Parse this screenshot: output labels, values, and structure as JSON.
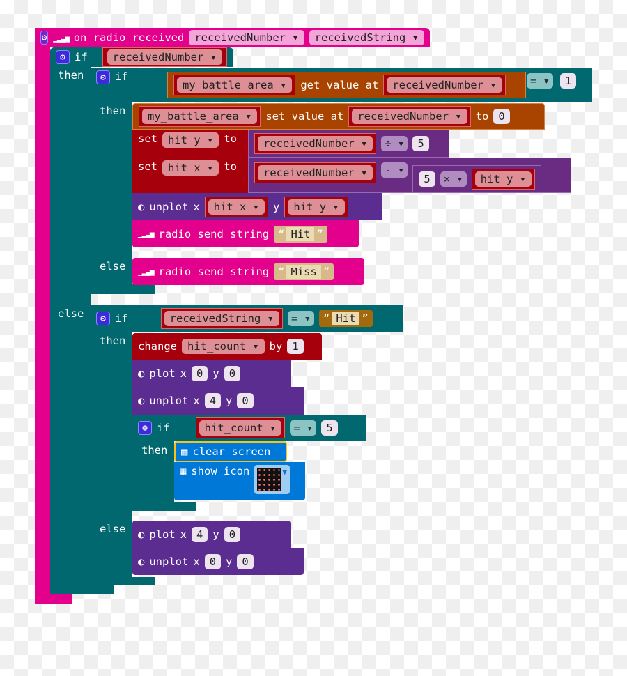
{
  "event": {
    "label": "on radio received",
    "params": [
      "receivedNumber",
      "receivedString"
    ],
    "color": "#e3008c"
  },
  "kw": {
    "if": "if",
    "then": "then",
    "else": "else",
    "set": "set",
    "to": "to",
    "by": "by",
    "x": "x",
    "y": "y",
    "change": "change"
  },
  "outer_if": {
    "cond": "receivedNumber"
  },
  "if1": {
    "array": "my_battle_area",
    "get_label": "get value at",
    "index": "receivedNumber",
    "op": "=",
    "value": "1"
  },
  "set_value": {
    "array": "my_battle_area",
    "label": "set value at",
    "index": "receivedNumber",
    "value": "0"
  },
  "set_hit_y": {
    "var": "hit_y",
    "lhs": "receivedNumber",
    "op": "÷",
    "rhs": "5"
  },
  "set_hit_x": {
    "var": "hit_x",
    "lhs": "receivedNumber",
    "op": "-",
    "a": "5",
    "mul": "×",
    "b": "hit_y"
  },
  "unplot1": {
    "label": "unplot",
    "x": "hit_x",
    "y": "hit_y"
  },
  "send_hit": {
    "label": "radio send string",
    "value": "Hit"
  },
  "send_miss": {
    "label": "radio send string",
    "value": "Miss"
  },
  "if2": {
    "var": "receivedString",
    "op": "=",
    "value": "Hit"
  },
  "change": {
    "var": "hit_count",
    "value": "1"
  },
  "plot1": {
    "label": "plot",
    "x": "0",
    "y": "0"
  },
  "unplot2": {
    "label": "unplot",
    "x": "4",
    "y": "0"
  },
  "if3": {
    "var": "hit_count",
    "op": "=",
    "value": "5"
  },
  "clear": {
    "label": "clear screen"
  },
  "show_icon": {
    "label": "show icon"
  },
  "plot2": {
    "label": "plot",
    "x": "4",
    "y": "0"
  },
  "unplot3": {
    "label": "unplot",
    "x": "0",
    "y": "0"
  }
}
